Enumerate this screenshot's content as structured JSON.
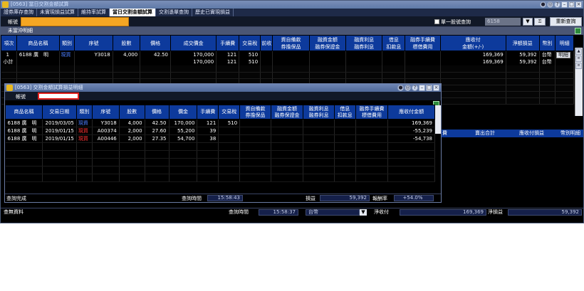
{
  "window": {
    "title": "[0563] 當日交割金額試算",
    "tabs": [
      "證券庫存查詢",
      "未實現損益試算",
      "維持率試算",
      "當日交割金額試算",
      "交割憑單查詢",
      "歷史已實現損益"
    ],
    "active_tab": 3
  },
  "filter": {
    "account_label": "帳號",
    "single_stock_label": "單一股號查詢",
    "stock_code_placeholder": "6158",
    "drop_label": "▼",
    "icon2_label": "⚿",
    "requery_label": "重新查詢"
  },
  "section": {
    "title": "未當沖明細"
  },
  "main_table": {
    "headers": [
      "項次",
      "商品名稱",
      "類別",
      "序號",
      "股數",
      "價格",
      "成交價金",
      "手續費",
      "交易稅",
      "前收",
      "資自備款\n券擔保品",
      "融資金額\n融券保證金",
      "融資利息\n融券利息",
      "借息\n扣款息",
      "融券手續費\n標借費用",
      "應收付\n金額(+/-)",
      "淨額損益",
      "幣別",
      "明細"
    ],
    "rows": [
      [
        "1",
        "6188 廣　明",
        "現買",
        "Y3018",
        "4,000",
        "42.50",
        "170,000",
        "121",
        "510",
        "",
        "",
        "",
        "",
        "",
        "",
        "169,369",
        "59,392",
        "台幣",
        "明細"
      ],
      [
        "小計",
        "",
        "",
        "",
        "",
        "",
        "170,000",
        "121",
        "510",
        "",
        "",
        "",
        "",
        "",
        "",
        "169,369",
        "59,392",
        "台幣",
        ""
      ]
    ]
  },
  "lower_right": {
    "headers": [
      "費",
      "賣出合計",
      "應收付損益",
      "幣別",
      "明細"
    ]
  },
  "main_status": {
    "status_text": "查無資料",
    "query_time_label": "查詢時間",
    "query_time": "15:58:37",
    "currency": "台幣",
    "drop_label": "▼",
    "net_label": "淨收付",
    "net_value": "169,369",
    "pnl_label": "淨損益",
    "pnl_value": "59,392"
  },
  "child": {
    "title": "[0563] 交割金額試算損益明細",
    "account_label": "帳號",
    "headers": [
      "商品名稱",
      "交易日期",
      "類別",
      "序號",
      "股數",
      "價格",
      "價金",
      "手續費",
      "交易稅",
      "資自備款\n券擔保品",
      "融資金額\n融券保證金",
      "融資利息\n融券利息",
      "借息\n扣款息",
      "融券手續費\n標借費用",
      "應收付金額"
    ],
    "rows": [
      [
        "6188 廣　明",
        "2019/03/05",
        "現資",
        "Y3018",
        "4,000",
        "42.50",
        "170,000",
        "121",
        "510",
        "",
        "",
        "",
        "",
        "",
        "169,369"
      ],
      [
        "6188 廣　明",
        "2019/01/15",
        "現買",
        "A00374",
        "2,000",
        "27.60",
        "55,200",
        "39",
        "",
        "",
        "",
        "",
        "",
        "",
        "-55,239"
      ],
      [
        "6188 廣　明",
        "2019/01/15",
        "現買",
        "A00446",
        "2,000",
        "27.35",
        "54,700",
        "38",
        "",
        "",
        "",
        "",
        "",
        "",
        "-54,738"
      ]
    ],
    "status_text": "查詢完成",
    "query_time_label": "查詢時間",
    "query_time": "15:58:43",
    "pnl_label": "損益",
    "pnl_value": "59,392",
    "roi_label": "報酬率",
    "roi_value": "+54.0%"
  },
  "colors": {
    "header_blue": "#0d3a9c",
    "account_orange": "#f5a623",
    "sell_red": "#ff3333",
    "buy_blue": "#4a7dff"
  }
}
